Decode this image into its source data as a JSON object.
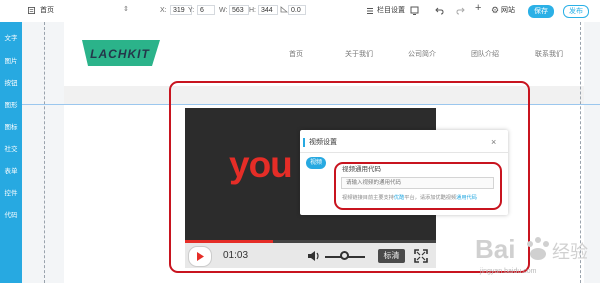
{
  "toolbar": {
    "page_label": "首页",
    "page_dropdown_icon": "chevron-updown-icon",
    "x_label": "X:",
    "x_value": "319",
    "y_label": "Y:",
    "y_value": "6",
    "w_label": "W:",
    "w_value": "563",
    "h_label": "H:",
    "h_value": "344",
    "r_value": "0.0",
    "column_settings_label": "栏目设置",
    "website_label": "网站",
    "save_label": "保存",
    "publish_label": "发布"
  },
  "sidebar": {
    "items": [
      {
        "label": "文字"
      },
      {
        "label": "图片"
      },
      {
        "label": "按钮"
      },
      {
        "label": "图形"
      },
      {
        "label": "图标"
      },
      {
        "label": "社交"
      },
      {
        "label": "表单"
      },
      {
        "label": "控件"
      },
      {
        "label": "代码"
      }
    ]
  },
  "site": {
    "logo_text": "LACHKIT",
    "nav": [
      {
        "label": "首页"
      },
      {
        "label": "关于我们"
      },
      {
        "label": "公司简介"
      },
      {
        "label": "团队介绍"
      },
      {
        "label": "联系我们"
      }
    ]
  },
  "video": {
    "brand_text": "you",
    "time": "01:03",
    "quality": "标清",
    "progress": 0.35
  },
  "dialog": {
    "title": "视频设置",
    "close_glyph": "×",
    "tab_label": "视频",
    "field_label": "视频通用代码",
    "input_placeholder": "请输入视频的通用代码",
    "hint_prefix": "视频链接目前主要支持",
    "hint_link1": "优酷",
    "hint_mid": "平台，请添加优酷视频",
    "hint_link2": "通用代码"
  },
  "watermark": {
    "text": "jingyan.baidu.com"
  },
  "colors": {
    "accent": "#27a9e1",
    "annotation_red": "#c8141f",
    "video_brand": "#e52d27",
    "logo_green": "#2bb38a"
  }
}
